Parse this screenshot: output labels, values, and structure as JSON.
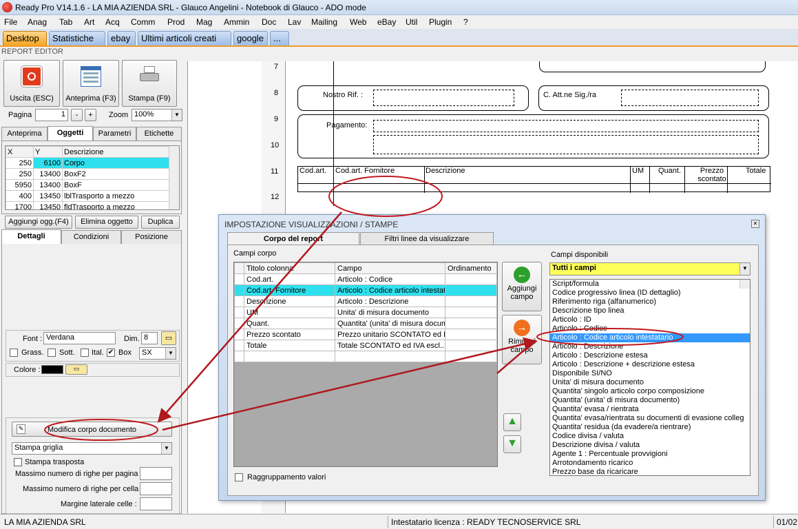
{
  "window": {
    "title": "Ready Pro V14.1.6 - LA MIA AZIENDA SRL - Glauco Angelini - Notebook di Glauco - ADO mode"
  },
  "menu": [
    "File",
    "Anag",
    "Tab",
    "Art",
    "Acq",
    "Comm",
    "Prod",
    "Mag",
    "Ammin",
    "Doc",
    "Lav",
    "Mailing",
    "Web",
    "eBay",
    "Util",
    "Plugin",
    "?"
  ],
  "desktop_tabs": [
    "Desktop",
    "Statistiche",
    "ebay",
    "Ultimi articoli creati",
    "google",
    "..."
  ],
  "report_editor": {
    "title": "REPORT EDITOR",
    "buttons": {
      "exit": "Uscita (ESC)",
      "preview": "Anteprima (F3)",
      "print": "Stampa (F9)"
    },
    "page_label": "Pagina",
    "page_value": "1",
    "minus": "-",
    "plus": "+",
    "zoom_label": "Zoom",
    "zoom_value": "100%",
    "tabs": [
      "Anteprima",
      "Oggetti",
      "Parametri",
      "Etichette"
    ],
    "grid_headers": [
      "X",
      "Y",
      "Descrizione"
    ],
    "grid_rows": [
      {
        "x": "250",
        "y": "6100",
        "d": "Corpo"
      },
      {
        "x": "250",
        "y": "13400",
        "d": "BoxF2"
      },
      {
        "x": "5950",
        "y": "13400",
        "d": "BoxF"
      },
      {
        "x": "400",
        "y": "13450",
        "d": "lblTrasporto a mezzo"
      },
      {
        "x": "1700",
        "y": "13450",
        "d": "fldTrasporto a mezzo"
      }
    ],
    "add_obj": "Aggiungi ogg.(F4)",
    "del_obj": "Elimina oggetto",
    "dup": "Duplica",
    "tabs2": [
      "Dettagli",
      "Condizioni",
      "Posizione"
    ],
    "font_label": "Font :",
    "font_value": "Verdana",
    "dim_label": "Dim.",
    "dim_value": "8",
    "grass": "Grass.",
    "sott": "Sott.",
    "ital": "Ital.",
    "box": "Box",
    "align": "SX",
    "color_label": "Colore :",
    "edit_body": "Modifica corpo documento",
    "grid_print": "Stampa griglia",
    "transposed": "Stampa trasposta",
    "max_rows_page": "Massimo numero di righe per pagina :",
    "max_rows_cell": "Massimo numero di righe per cella :",
    "margin": "Margine laterale celle :"
  },
  "canvas": {
    "ruler": [
      "7",
      "8",
      "9",
      "10",
      "11",
      "12"
    ],
    "nostro_rif": "Nostro Rif. :",
    "att": "C. Att.ne Sig./ra",
    "pagamento": "Pagamento:",
    "headers": [
      "Cod.art.",
      "Cod.art. Fornitore",
      "Descrizione",
      "UM",
      "Quant.",
      "Prezzo scontato",
      "Totale"
    ]
  },
  "dialog": {
    "title": "IMPOSTAZIONE VISUALIZZAZIONI / STAMPE",
    "tabs": [
      "Corpo del report",
      "Filtri linee da visualizzare"
    ],
    "campi_corpo": "Campi corpo",
    "col_headers": [
      "Titolo colonna",
      "Campo",
      "Ordinamento"
    ],
    "rows": [
      {
        "t": "Cod.art.",
        "c": "Articolo : Codice"
      },
      {
        "t": "Cod.art. Fornitore",
        "c": "Articolo : Codice articolo intestat..."
      },
      {
        "t": "Descrizione",
        "c": "Articolo : Descrizione"
      },
      {
        "t": "UM",
        "c": "Unita' di misura documento"
      },
      {
        "t": "Quant.",
        "c": "Quantita' (unita' di misura docum..."
      },
      {
        "t": "Prezzo scontato",
        "c": "Prezzo unitario SCONTATO ed I..."
      },
      {
        "t": "Totale",
        "c": "Totale SCONTATO ed IVA escl..."
      }
    ],
    "add_field": "Aggiungi campo",
    "remove_field": "Rimuovi campo",
    "grouping": "Raggruppamento valori",
    "avail_label": "Campi disponibili",
    "avail_filter": "Tutti i campi",
    "avail": [
      "Script/formula",
      "Codice progressivo linea (ID dettaglio)",
      "Riferimento riga (alfanumerico)",
      "Descrizione tipo linea",
      "Articolo : ID",
      "Articolo : Codice",
      "Articolo : Codice articolo intestatario",
      "Articolo : Descrizione",
      "Articolo : Descrizione estesa",
      "Articolo : Descrizione + descrizione estesa",
      "Disponibile SI/NO",
      "Unita' di misura documento",
      "Quantita' singolo articolo corpo composizione",
      "Quantita' (unita' di misura documento)",
      "Quantita' evasa / rientrata",
      "Quantita' evasa/rientrata su documenti di evasione colleg",
      "Quantita' residua (da evadere/a rientrare)",
      "Codice divisa / valuta",
      "Descrizione divisa / valuta",
      "Agente 1 : Percentuale provvigioni",
      "Arrotondamento ricarico",
      "Prezzo base da ricaricare"
    ]
  },
  "status": {
    "company": "LA MIA AZIENDA SRL",
    "license": "Intestatario licenza : READY TECNOSERVICE SRL",
    "date": "01/02"
  }
}
